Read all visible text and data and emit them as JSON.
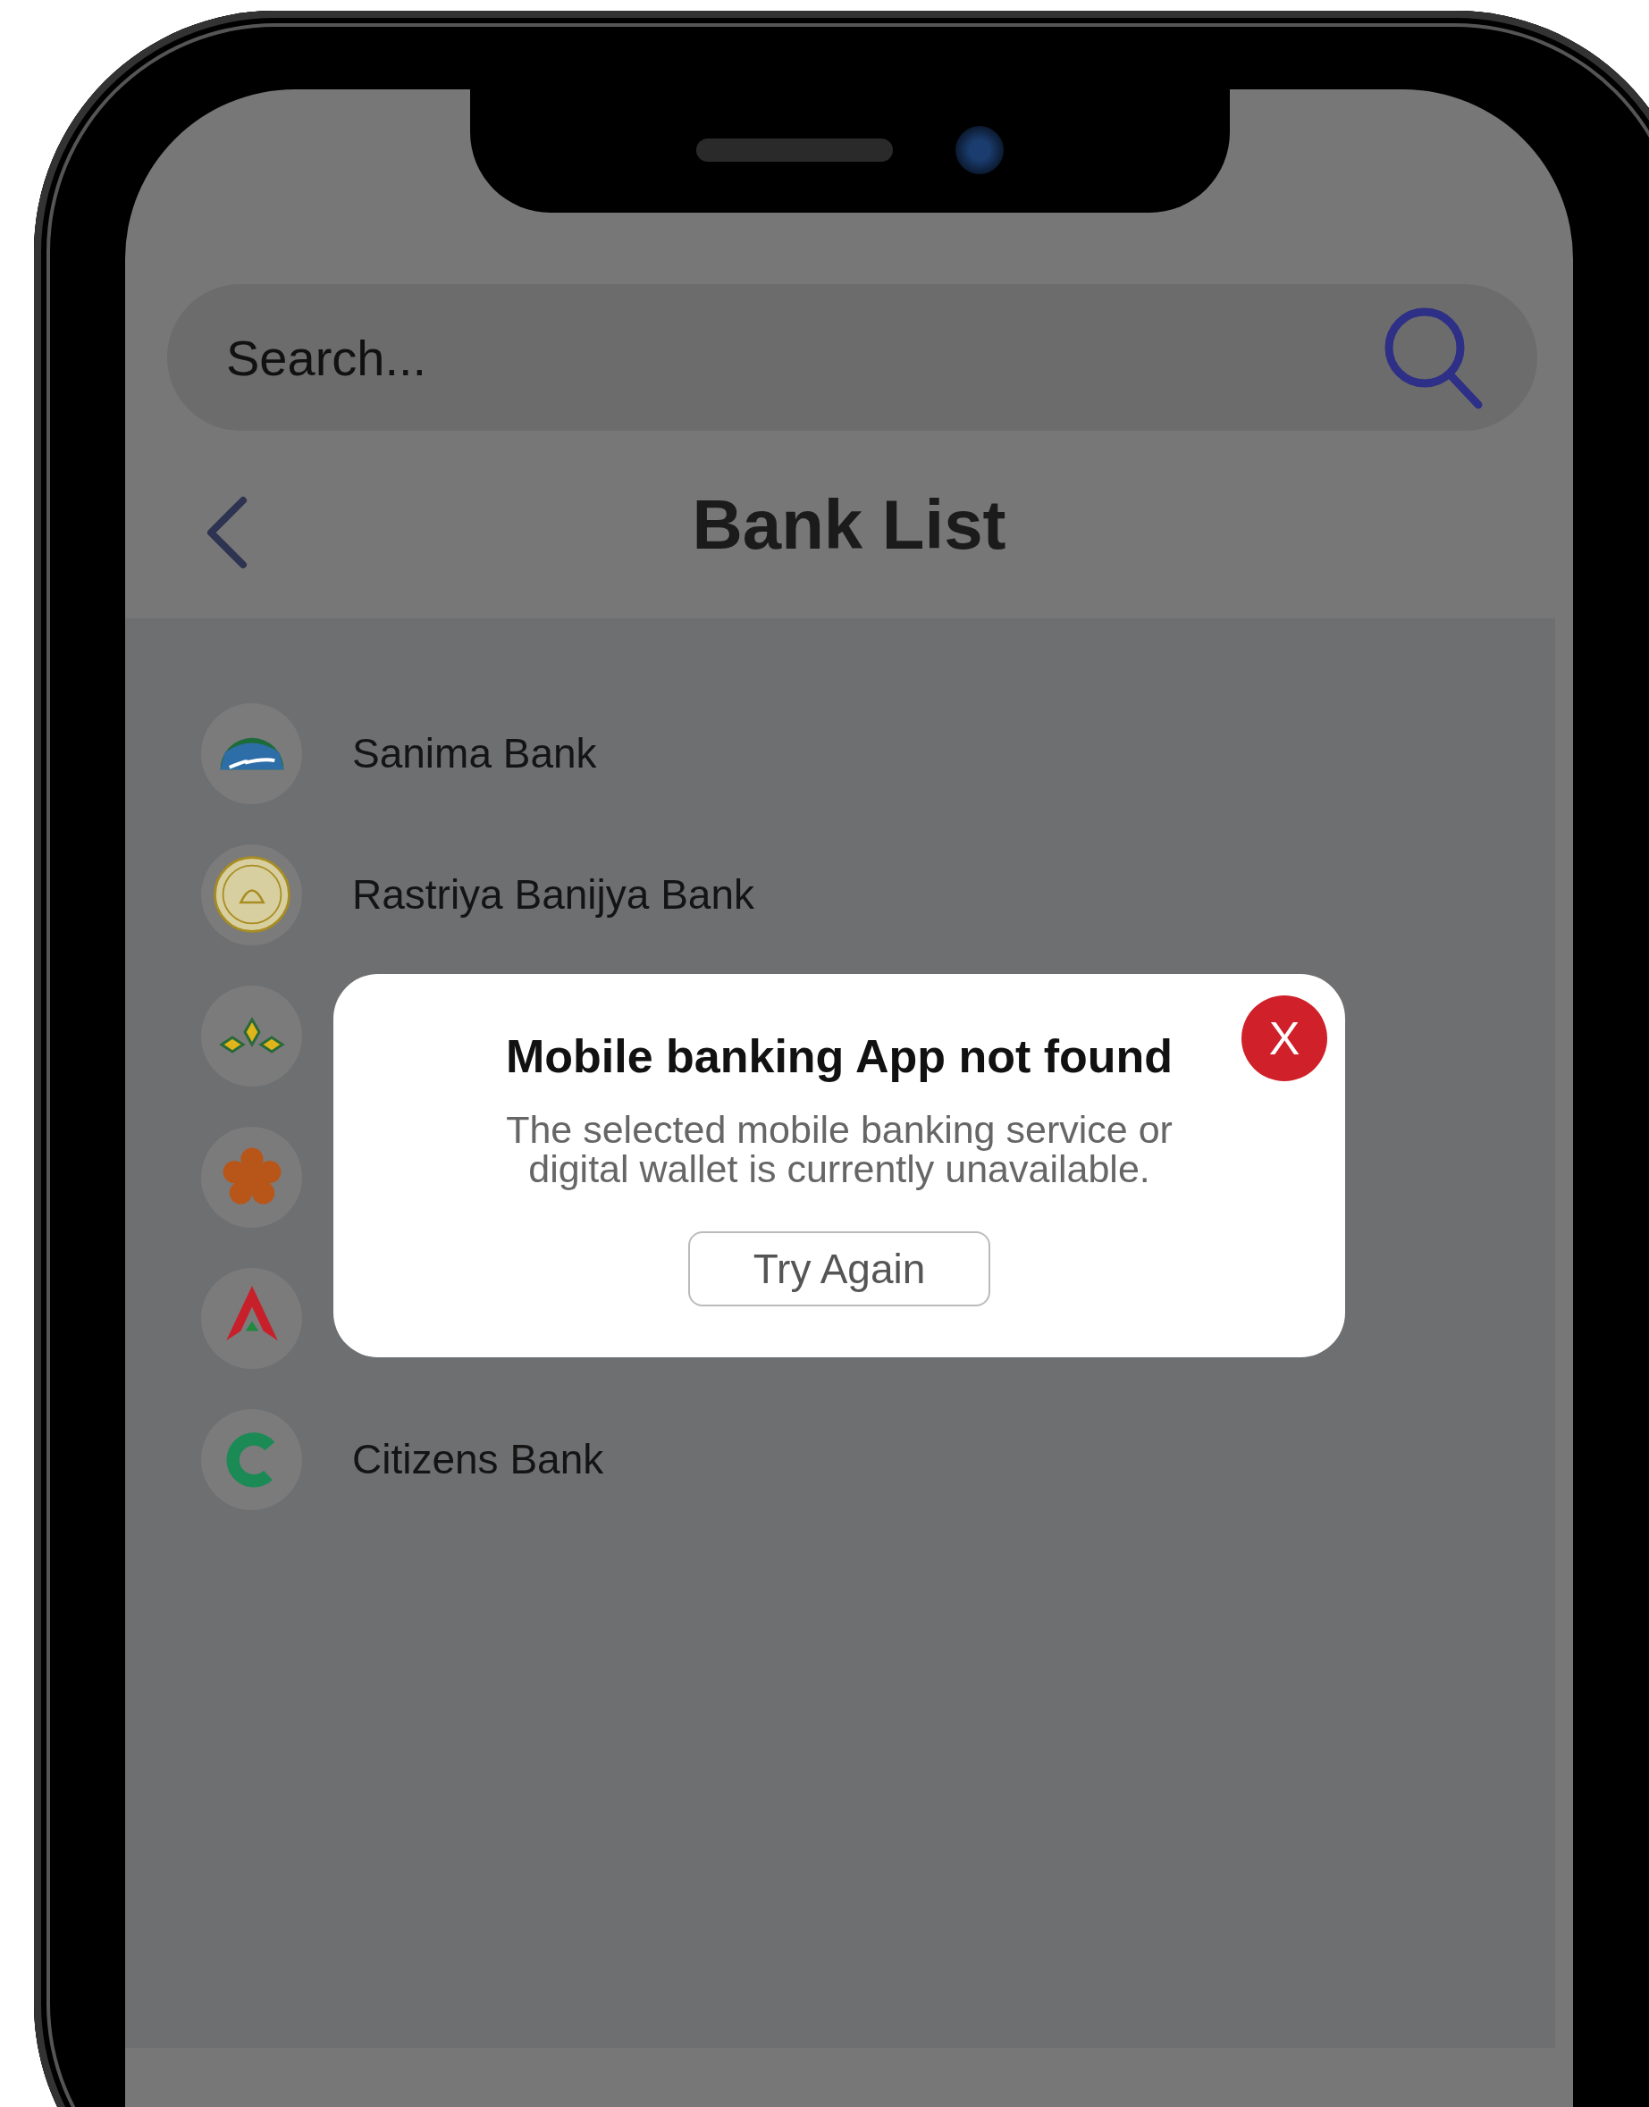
{
  "search": {
    "placeholder": "Search..."
  },
  "header": {
    "title": "Bank List"
  },
  "banks": [
    {
      "kind": "landscape",
      "name": "Sanima Bank"
    },
    {
      "kind": "emblem",
      "name": "Rastriya Banijya Bank"
    },
    {
      "kind": "diamonds"
    },
    {
      "kind": "flower"
    },
    {
      "kind": "peak"
    },
    {
      "kind": "arc",
      "name": "Citizens Bank"
    }
  ],
  "dialog": {
    "title": "Mobile banking App not found",
    "message": "The selected mobile banking service or digital wallet is currently unavailable.",
    "button": "Try Again",
    "close": "X"
  }
}
